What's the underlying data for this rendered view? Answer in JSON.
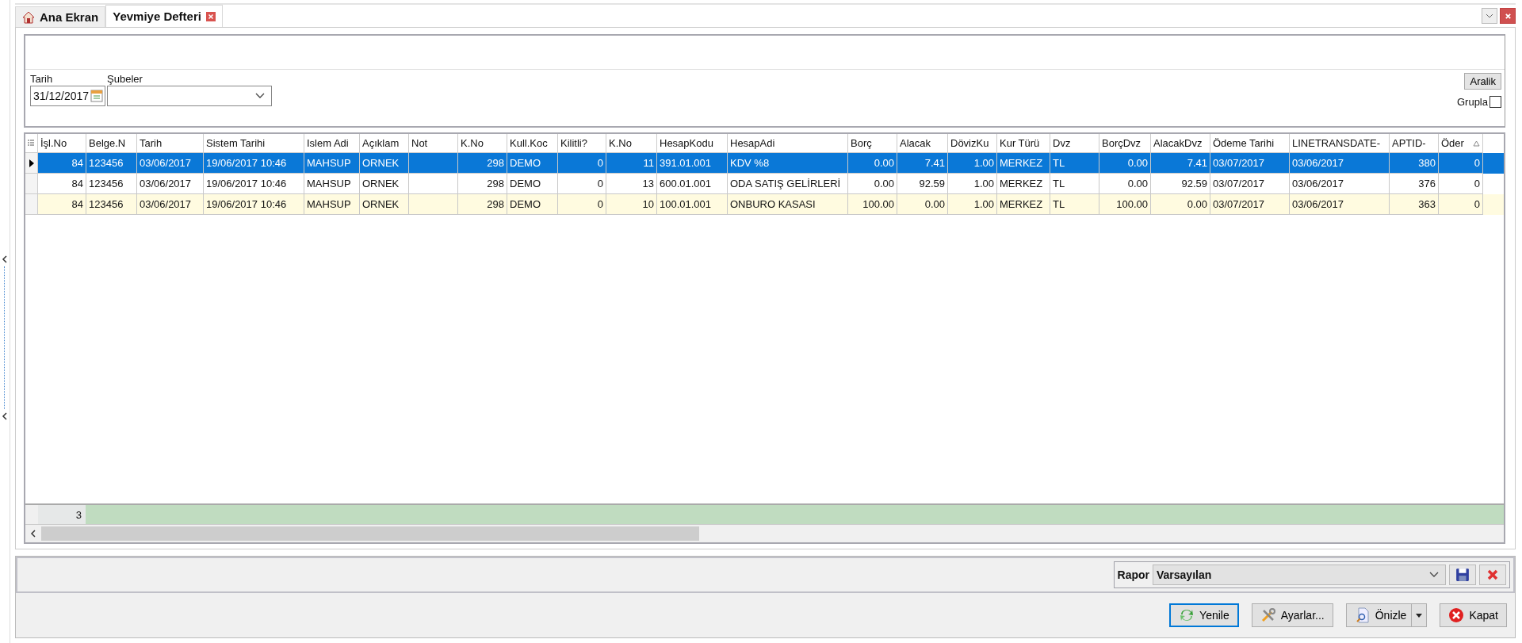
{
  "tabs": [
    {
      "label": "Ana Ekran",
      "selected": false,
      "kind": "home"
    },
    {
      "label": "Yevmiye Defteri",
      "selected": true,
      "kind": "closable"
    }
  ],
  "filters": {
    "date_label": "Tarih",
    "date_value": "31/12/2017",
    "branch_label": "Şubeler",
    "range_button": "Aralik",
    "group_checkbox": {
      "label": "Grupla",
      "checked": false
    }
  },
  "grid": {
    "columns": [
      {
        "label": "İşl.No",
        "kind": "number"
      },
      {
        "label": "Belge.N",
        "kind": "text"
      },
      {
        "label": "Tarih",
        "kind": "text"
      },
      {
        "label": "Sistem Tarihi",
        "kind": "text"
      },
      {
        "label": "Islem Adi",
        "kind": "text"
      },
      {
        "label": "Açıklam",
        "kind": "text"
      },
      {
        "label": "Not",
        "kind": "text"
      },
      {
        "label": "K.No",
        "kind": "number"
      },
      {
        "label": "Kull.Koc",
        "kind": "text"
      },
      {
        "label": "Kilitli?",
        "kind": "number"
      },
      {
        "label": "K.No",
        "kind": "number"
      },
      {
        "label": "HesapKodu",
        "kind": "text"
      },
      {
        "label": "HesapAdi",
        "kind": "text"
      },
      {
        "label": "Borç",
        "kind": "number"
      },
      {
        "label": "Alacak",
        "kind": "number"
      },
      {
        "label": "DövizKu",
        "kind": "number"
      },
      {
        "label": "Kur Türü",
        "kind": "text"
      },
      {
        "label": "Dvz",
        "kind": "text"
      },
      {
        "label": "BorçDvz",
        "kind": "number"
      },
      {
        "label": "AlacakDvz",
        "kind": "number"
      },
      {
        "label": "Ödeme Tarihi",
        "kind": "text"
      },
      {
        "label": "LINETRANSDATE-",
        "kind": "text"
      },
      {
        "label": "APTID-",
        "kind": "number"
      },
      {
        "label": "Öder",
        "kind": "number",
        "sorted": true
      }
    ],
    "rows": [
      {
        "selected": true,
        "cells": [
          "84",
          "123456",
          "03/06/2017",
          "19/06/2017 10:46",
          "MAHSUP",
          "ORNEK",
          null,
          "298",
          "DEMO",
          "0",
          "11",
          "391.01.001",
          "KDV %8",
          "0.00",
          "7.41",
          "1.00",
          "MERKEZ",
          "TL",
          "0.00",
          "7.41",
          "03/07/2017",
          "03/06/2017",
          "380",
          "0"
        ]
      },
      {
        "selected": false,
        "cells": [
          "84",
          "123456",
          "03/06/2017",
          "19/06/2017 10:46",
          "MAHSUP",
          "ORNEK",
          null,
          "298",
          "DEMO",
          "0",
          "13",
          "600.01.001",
          "ODA SATIŞ GELİRLERİ",
          "0.00",
          "92.59",
          "1.00",
          "MERKEZ",
          "TL",
          "0.00",
          "92.59",
          "03/07/2017",
          "03/06/2017",
          "376",
          "0"
        ]
      },
      {
        "selected": false,
        "cells": [
          "84",
          "123456",
          "03/06/2017",
          "19/06/2017 10:46",
          "MAHSUP",
          "ORNEK",
          null,
          "298",
          "DEMO",
          "0",
          "10",
          "100.01.001",
          "ONBURO KASASI",
          "100.00",
          "0.00",
          "1.00",
          "MERKEZ",
          "TL",
          "100.00",
          "0.00",
          "03/07/2017",
          "03/06/2017",
          "363",
          "0"
        ]
      }
    ],
    "footer_count": "3"
  },
  "report": {
    "label": "Rapor",
    "value": "Varsayılan"
  },
  "buttons": [
    {
      "label": "Yenile",
      "kind": "refresh",
      "focused": true
    },
    {
      "label": "Ayarlar...",
      "kind": "settings",
      "focused": false
    },
    {
      "label": "Önizle",
      "kind": "preview",
      "focused": false
    },
    {
      "label": "Kapat",
      "kind": "close",
      "focused": false
    }
  ]
}
